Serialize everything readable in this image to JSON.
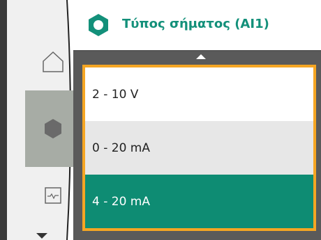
{
  "header": {
    "title": "Τύπος σήματος (AI1)",
    "icon": "gear-icon",
    "accent": "#13907a"
  },
  "nav": {
    "items": [
      {
        "icon": "home-icon",
        "active": false
      },
      {
        "icon": "gear-icon",
        "active": true
      },
      {
        "icon": "monitor-icon",
        "active": false
      }
    ]
  },
  "options": [
    {
      "label": "2 - 10 V",
      "selected": false
    },
    {
      "label": "0 - 20 mA",
      "selected": false
    },
    {
      "label": "4 - 20 mA",
      "selected": true
    }
  ],
  "colors": {
    "selection": "#0e8c73",
    "focus_border": "#f5a623",
    "active_nav": "#a7aca5"
  }
}
